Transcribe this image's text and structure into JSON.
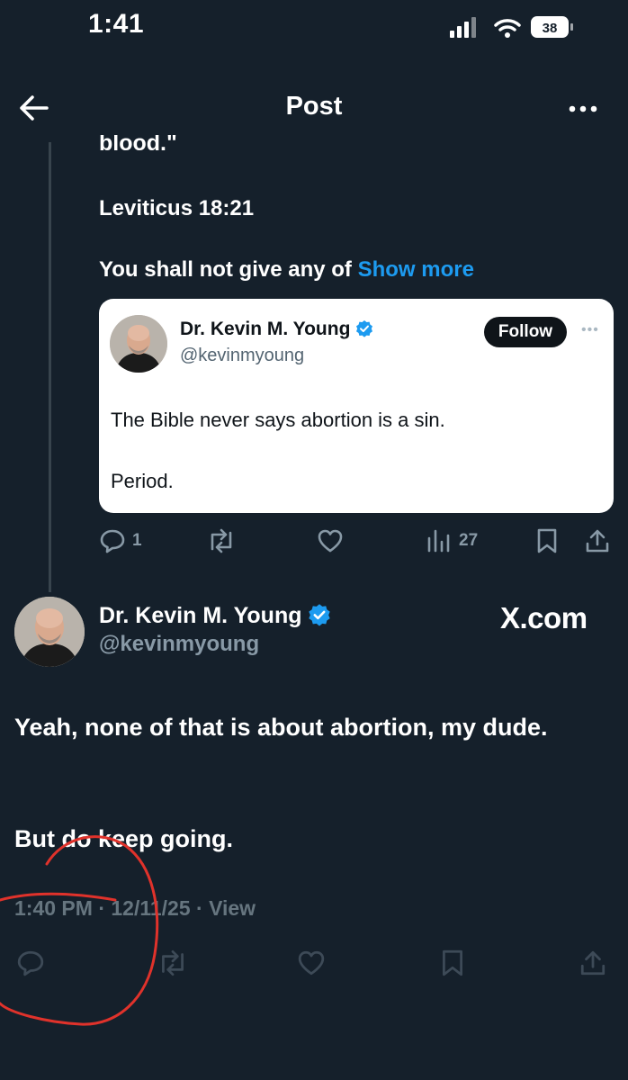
{
  "status_bar": {
    "time": "1:41",
    "battery": "38"
  },
  "header": {
    "title": "Post"
  },
  "parent_post": {
    "cut_text": "blood.\"",
    "reference": "Leviticus 18:21",
    "text": "You shall not give any of",
    "show_more": "Show more",
    "quoted": {
      "name": "Dr. Kevin M. Young",
      "handle": "@kevinmyoung",
      "follow_label": "Follow",
      "line1": "The Bible never says abortion is a sin.",
      "line2": "Period."
    },
    "stats": {
      "replies": "1",
      "views": "27"
    }
  },
  "main_post": {
    "name": "Dr. Kevin M. Young",
    "handle": "@kevinmyoung",
    "watermark": "X.com",
    "text1": "Yeah, none of that is about abortion, my dude.",
    "text2": "But do keep going.",
    "timestamp": "1:40 PM · 12/11/25 · View"
  },
  "colors": {
    "background": "#15202b",
    "accent": "#1d9bf0",
    "verified": "#1d9bf0",
    "annotation": "#e0322b"
  }
}
